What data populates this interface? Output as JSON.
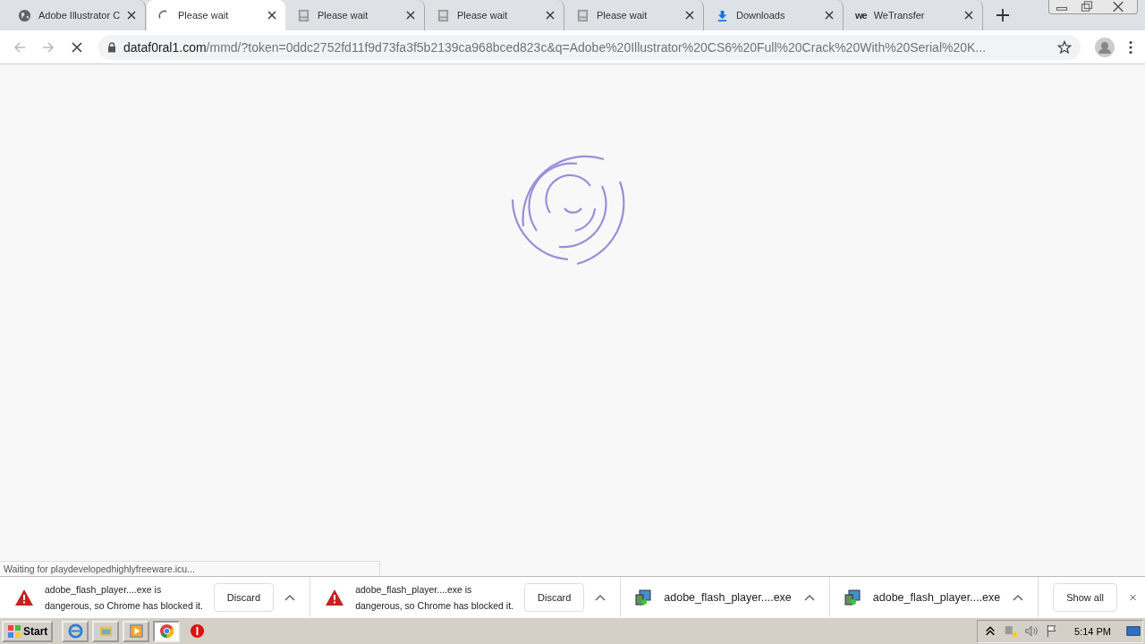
{
  "tabs": [
    {
      "title": "Adobe Illustrator C",
      "kind": "globe",
      "selected": false
    },
    {
      "title": "Please wait",
      "kind": "spinner",
      "selected": true
    },
    {
      "title": "Please wait",
      "kind": "page",
      "selected": false
    },
    {
      "title": "Please wait",
      "kind": "page",
      "selected": false
    },
    {
      "title": "Please wait",
      "kind": "page",
      "selected": false
    },
    {
      "title": "Downloads",
      "kind": "download",
      "selected": false
    },
    {
      "title": "WeTransfer",
      "kind": "logo",
      "logo_text": "we",
      "selected": false
    }
  ],
  "address_bar": {
    "host": "dataf0ral1.com",
    "path": "/mmd/?token=0ddc2752fd11f9d73fa3f5b2139ca968bced823c&q=Adobe%20Illustrator%20CS6%20Full%20Crack%20With%20Serial%20K...",
    "loading": true
  },
  "status_bubble": "Waiting for playdevelopedhighlyfreeware.icu...",
  "downloads": [
    {
      "kind": "blocked",
      "line1": "adobe_flash_player....exe is",
      "line2": "dangerous, so Chrome has blocked it.",
      "button": "Discard"
    },
    {
      "kind": "blocked",
      "line1": "adobe_flash_player....exe is",
      "line2": "dangerous, so Chrome has blocked it.",
      "button": "Discard"
    },
    {
      "kind": "file",
      "name": "adobe_flash_player....exe"
    },
    {
      "kind": "file",
      "name": "adobe_flash_player....exe"
    }
  ],
  "show_all": "Show all",
  "taskbar": {
    "start": "Start",
    "apps": [
      {
        "kind": "ie",
        "selected": false
      },
      {
        "kind": "folder",
        "selected": false
      },
      {
        "kind": "media",
        "selected": false
      },
      {
        "kind": "chrome",
        "selected": true
      },
      {
        "kind": "stop",
        "selected": false
      }
    ],
    "time": "5:14 PM"
  }
}
